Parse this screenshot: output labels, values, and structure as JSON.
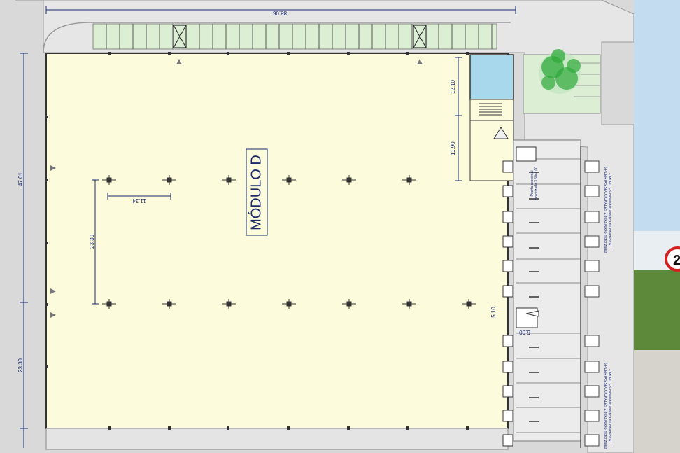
{
  "module_label": "MÓDULO D",
  "dimensions": {
    "top_width": "88.06",
    "left_upper": "47.01",
    "left_lower": "23.30",
    "office_upper": "12.10",
    "office_lower": "11.90",
    "bay_x": "11.34",
    "bay_y": "23.30",
    "ramp_h": "5.10",
    "ramp_w": "5.00"
  },
  "dock_notes": {
    "upper_1": "6 PUERTAS SECCIONALES 2.80x3.00x45 motorizadas",
    "upper_2": "+ MUELLES capacidad estática 6T dinámica 6T",
    "lower_1": "6 PUERTAS SECCIONALES 2.80x3.00x45 motorizadas",
    "lower_2": "+ MUELLES capacidad estática 6T dinámica 6T",
    "ramp_1": "Puerta seccional",
    "ramp_2": "motorizada 3.50x4.00"
  },
  "sign": {
    "text": "2"
  },
  "colors": {
    "warehouse_floor": "#fcfbdc",
    "office": "#a8d8ec",
    "green_strip": "#dcefd5",
    "tree": "#2faa3a",
    "line": "#1a2a6c"
  }
}
